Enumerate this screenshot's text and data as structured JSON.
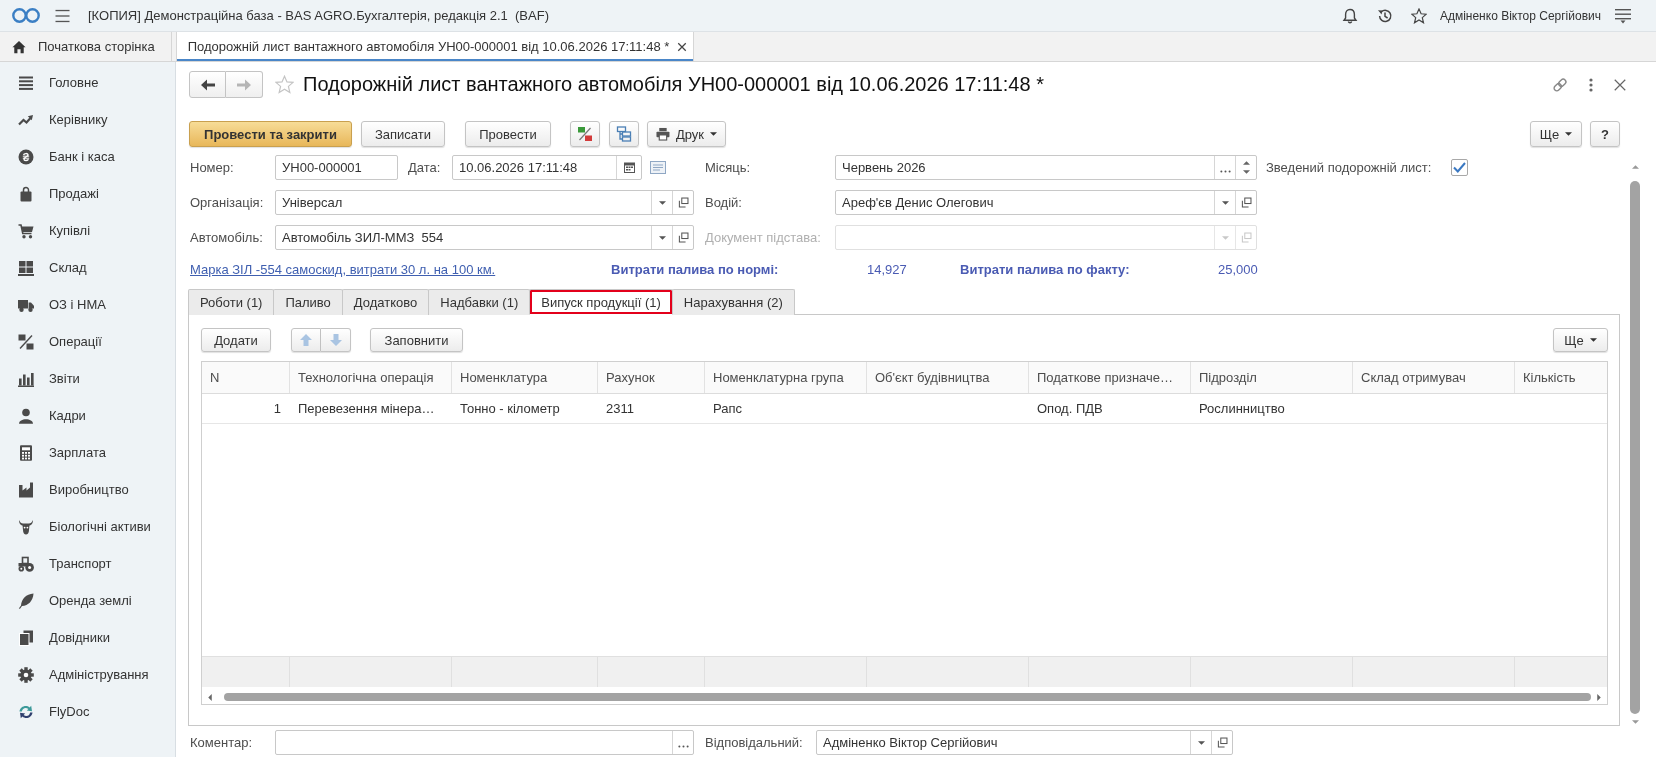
{
  "app_bar": {
    "title": "[КОПИЯ] Демонстраційна база - BAS AGRO.Бухгалтерія, редакція 2.1  (BAF)",
    "user": "Адміненко Віктор Сергійович"
  },
  "open_tabs": [
    {
      "kind": "home",
      "label": "Початкова сторінка",
      "selected": false
    },
    {
      "kind": "document",
      "label": "Подорожній лист вантажного автомобіля УН00-000001 від 10.06.2026 17:11:48 *",
      "selected": true
    }
  ],
  "sidebar": {
    "items": [
      {
        "label": "Головне"
      },
      {
        "label": "Керівнику"
      },
      {
        "label": "Банк і каса"
      },
      {
        "label": "Продажі"
      },
      {
        "label": "Купівлі"
      },
      {
        "label": "Склад"
      },
      {
        "label": "ОЗ і НМА"
      },
      {
        "label": "Операції"
      },
      {
        "label": "Звіти"
      },
      {
        "label": "Кадри"
      },
      {
        "label": "Зарплата"
      },
      {
        "label": "Виробництво"
      },
      {
        "label": "Біологічні активи"
      },
      {
        "label": "Транспорт"
      },
      {
        "label": "Оренда землі"
      },
      {
        "label": "Довідники"
      },
      {
        "label": "Адміністрування"
      },
      {
        "label": "FlyDoc"
      }
    ]
  },
  "document": {
    "title": "Подорожній лист вантажного автомобіля УН00-000001 від 10.06.2026 17:11:48 *"
  },
  "toolbar": {
    "buttons": [
      {
        "kind": "primary",
        "label": "Провести та закрити"
      },
      {
        "kind": "plain",
        "label": "Записати"
      },
      {
        "kind": "plain",
        "label": "Провести"
      },
      {
        "kind": "icon"
      },
      {
        "kind": "icon"
      },
      {
        "kind": "menu",
        "label": "Друк"
      }
    ],
    "more": "Ще",
    "help": "?"
  },
  "header_fields": {
    "number": {
      "label": "Номер:",
      "value": "УН00-000001"
    },
    "date": {
      "label": "Дата:",
      "value": "10.06.2026 17:11:48"
    },
    "month": {
      "label": "Місяць:",
      "value": "Червень 2026"
    },
    "consolidated": {
      "label": "Зведений подорожній лист:",
      "checked": true
    },
    "organization": {
      "label": "Організація:",
      "value": "Універсал"
    },
    "driver": {
      "label": "Водій:",
      "value": "Ареф'єв Денис Олегович"
    },
    "vehicle": {
      "label": "Автомобіль:",
      "value": "Автомобіль ЗИЛ-ММЗ  554"
    },
    "base_document": {
      "label": "Документ підстава:",
      "disabled": true
    }
  },
  "summary": {
    "link": "Марка ЗІЛ -554 самоскид, витрати 30 л. на 100 км.",
    "norm_label": "Витрати палива по нормі:",
    "norm_value": "14,927",
    "fact_label": "Витрати палива по факту:",
    "fact_value": "25,000"
  },
  "form_tabs": [
    {
      "label": "Роботи (1)",
      "selected": false,
      "highlighted": false
    },
    {
      "label": "Паливо",
      "selected": false,
      "highlighted": false
    },
    {
      "label": "Додатково",
      "selected": false,
      "highlighted": false
    },
    {
      "label": "Надбавки (1)",
      "selected": false,
      "highlighted": false
    },
    {
      "label": "Випуск продукції (1)",
      "selected": true,
      "highlighted": true
    },
    {
      "label": "Нарахування (2)",
      "selected": false,
      "highlighted": false
    }
  ],
  "table_toolbar": {
    "add": "Додати",
    "fill": "Заповнити",
    "more": "Ще"
  },
  "table": {
    "columns": [
      "N",
      "Технологічна операція",
      "Номенклатура",
      "Рахунок",
      "Номенклатурна група",
      "Об'єкт будівництва",
      "Податкове призначе…",
      "Підрозділ",
      "Склад отримувач",
      "Кількість"
    ],
    "rows": [
      {
        "cells": [
          "1",
          "Перевезення мінера…",
          "Тонно - кілометр",
          "2311",
          "Рапс",
          null,
          "Опод. ПДВ",
          "Рослинництво",
          null,
          null
        ]
      }
    ]
  },
  "footer": {
    "comment": {
      "label": "Коментар:"
    },
    "responsible": {
      "label": "Відповідальний:",
      "value": "Адміненко Віктор Сергійович"
    }
  }
}
